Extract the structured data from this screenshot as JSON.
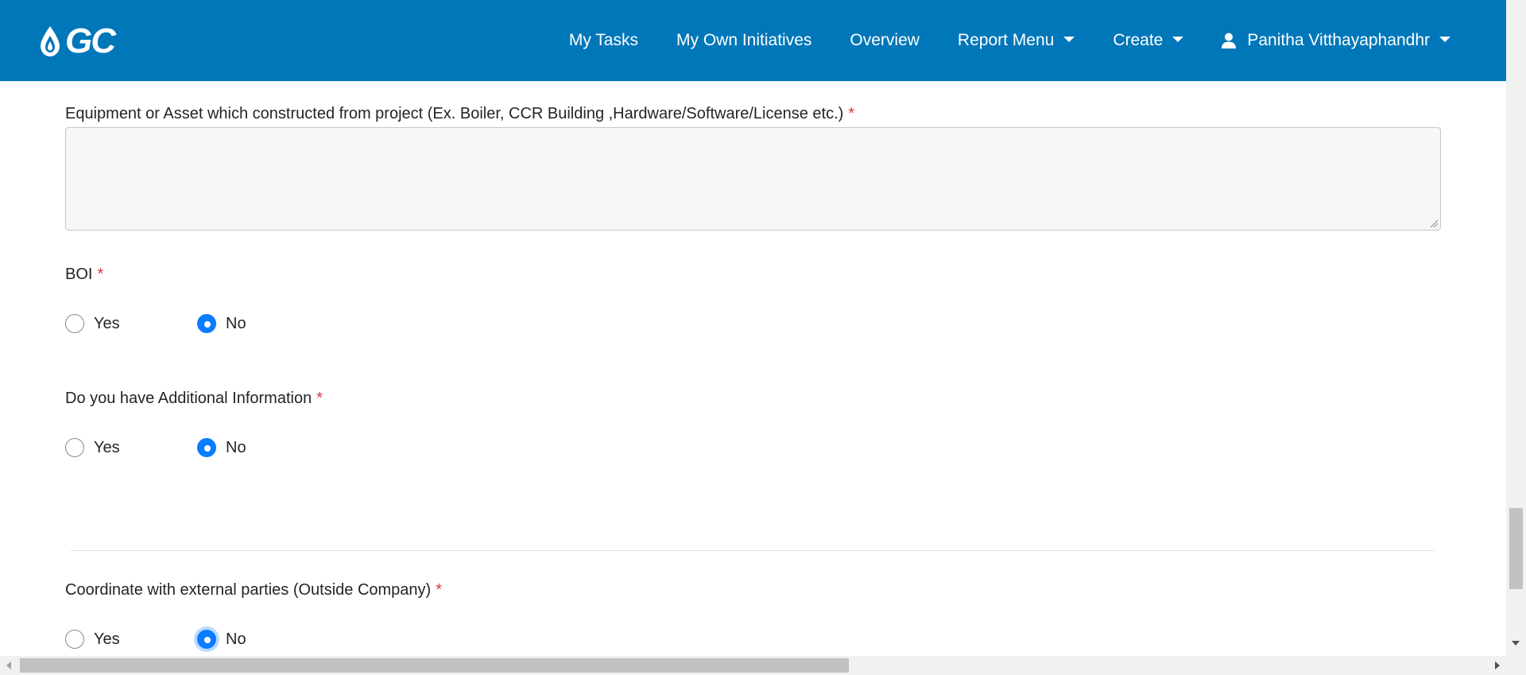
{
  "header": {
    "logo_text": "GC",
    "brand_color": "#0077b8",
    "nav": [
      {
        "label": "My Tasks"
      },
      {
        "label": "My Own Initiatives"
      },
      {
        "label": "Overview"
      },
      {
        "label": "Report Menu",
        "dropdown": true
      },
      {
        "label": "Create",
        "dropdown": true
      }
    ],
    "user": {
      "name": "Panitha Vitthayaphandhr",
      "icon": "user-icon"
    }
  },
  "form": {
    "equipment": {
      "label": "Equipment or Asset which constructed from project (Ex. Boiler, CCR Building ,Hardware/Software/License etc.)",
      "required_mark": "*",
      "value": ""
    },
    "boi": {
      "label": "BOI",
      "required_mark": "*",
      "options": [
        "Yes",
        "No"
      ],
      "selected": "No"
    },
    "additional_info": {
      "label": "Do you have Additional Information",
      "required_mark": "*",
      "options": [
        "Yes",
        "No"
      ],
      "selected": "No"
    },
    "external_parties": {
      "label": "Coordinate with external parties (Outside Company)",
      "required_mark": "*",
      "options": [
        "Yes",
        "No"
      ],
      "selected": "No"
    }
  },
  "colors": {
    "radio_checked": "#0a7cff",
    "required": "#dc3545"
  }
}
